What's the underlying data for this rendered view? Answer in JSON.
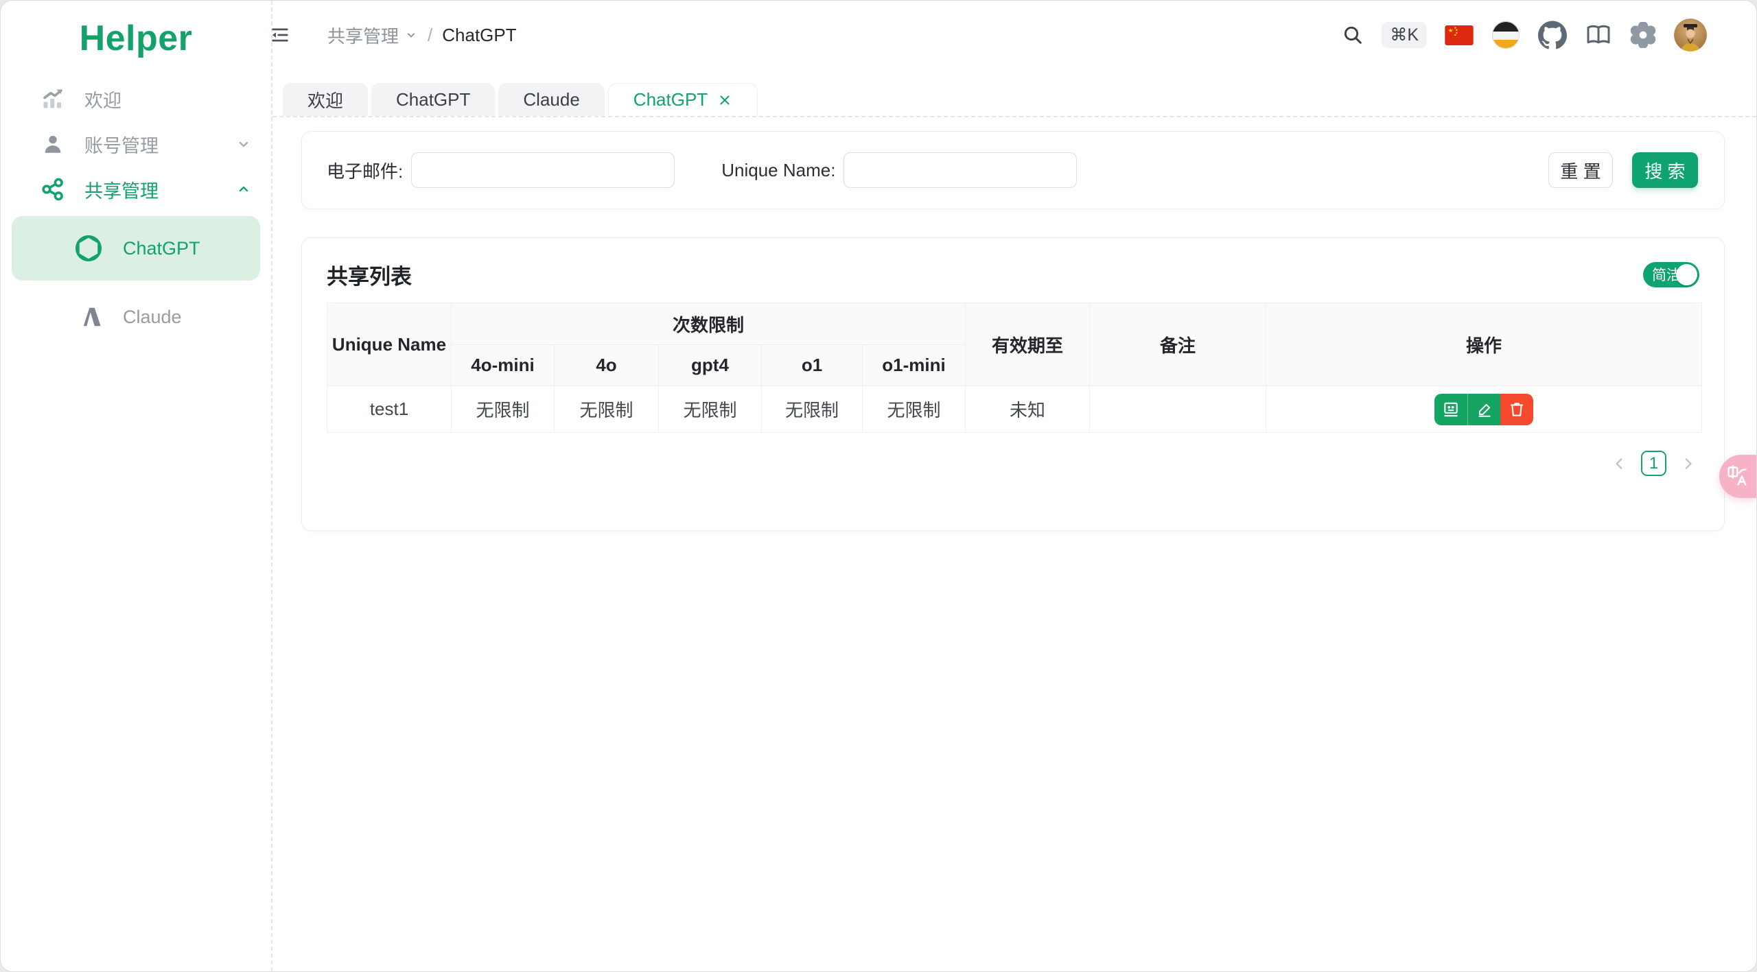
{
  "app": {
    "logo": "Helper"
  },
  "sidebar": {
    "items": [
      {
        "label": "欢迎"
      },
      {
        "label": "账号管理"
      },
      {
        "label": "共享管理"
      },
      {
        "label": "ChatGPT"
      },
      {
        "label": "Claude"
      }
    ]
  },
  "header": {
    "breadcrumb": {
      "parent": "共享管理",
      "separator": "/",
      "current": "ChatGPT"
    },
    "shortcut": "⌘K"
  },
  "tabs": [
    {
      "label": "欢迎"
    },
    {
      "label": "ChatGPT"
    },
    {
      "label": "Claude"
    },
    {
      "label": "ChatGPT"
    }
  ],
  "search_form": {
    "email_label": "电子邮件:",
    "email_value": "",
    "unique_label": "Unique Name:",
    "unique_value": "",
    "reset_label": "重 置",
    "search_label": "搜 索"
  },
  "list_card": {
    "title": "共享列表",
    "toggle_label": "简洁"
  },
  "table": {
    "header": {
      "unique_name": "Unique Name",
      "limits_group": "次数限制",
      "limit_cols": [
        "4o-mini",
        "4o",
        "gpt4",
        "o1",
        "o1-mini"
      ],
      "expiry": "有效期至",
      "note": "备注",
      "actions": "操作"
    },
    "rows": [
      {
        "unique_name": "test1",
        "limits": [
          "无限制",
          "无限制",
          "无限制",
          "无限制",
          "无限制"
        ],
        "expiry": "未知",
        "note": ""
      }
    ]
  },
  "pagination": {
    "page": "1"
  },
  "colors": {
    "accent_green": "#0ea36f",
    "active_bg": "#dcefe3",
    "danger_red": "#f54a2d",
    "translate_pink": "#f6b3c6"
  }
}
